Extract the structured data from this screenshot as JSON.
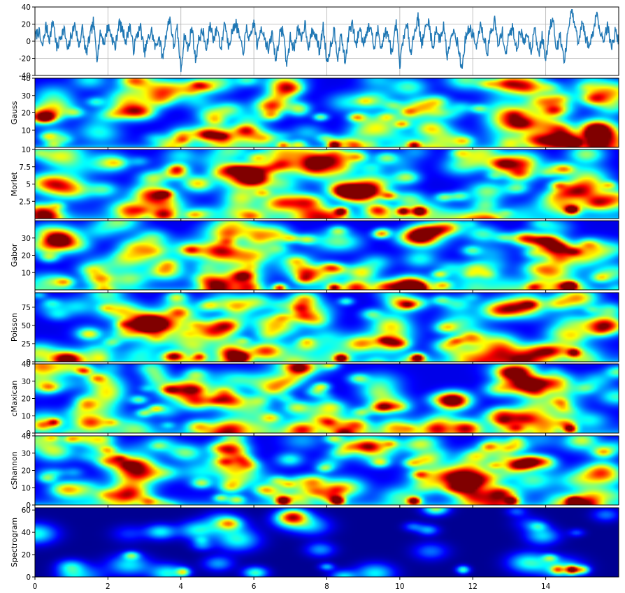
{
  "chart_data": [
    {
      "type": "line",
      "title": "",
      "xlabel": "",
      "ylabel": "",
      "xlim": [
        0,
        16
      ],
      "ylim": [
        -40,
        40
      ],
      "yticks": [
        -20,
        0,
        20,
        40
      ],
      "grid": true,
      "color": "#1f77b4",
      "series": [
        {
          "x": [
            0.0,
            0.1,
            0.2,
            0.3,
            0.4,
            0.5,
            0.6,
            0.7,
            0.8,
            0.9,
            1.0,
            1.1,
            1.2,
            1.3,
            1.4,
            1.5,
            1.6,
            1.7,
            1.8,
            1.9,
            2.0,
            2.1,
            2.2,
            2.3,
            2.4,
            2.5,
            2.6,
            2.7,
            2.8,
            2.9,
            3.0,
            3.1,
            3.2,
            3.3,
            3.4,
            3.5,
            3.6,
            3.7,
            3.8,
            3.9,
            4.0,
            4.1,
            4.2,
            4.3,
            4.4,
            4.5,
            4.6,
            4.7,
            4.8,
            4.9,
            5.0,
            5.1,
            5.2,
            5.3,
            5.4,
            5.5,
            5.6,
            5.7,
            5.8,
            5.9,
            6.0,
            6.1,
            6.2,
            6.3,
            6.4,
            6.5,
            6.6,
            6.7,
            6.8,
            6.9,
            7.0,
            7.1,
            7.2,
            7.3,
            7.4,
            7.5,
            7.6,
            7.7,
            7.8,
            7.9,
            8.0,
            8.1,
            8.2,
            8.3,
            8.4,
            8.5,
            8.6,
            8.7,
            8.8,
            8.9,
            9.0,
            9.1,
            9.2,
            9.3,
            9.4,
            9.5,
            9.6,
            9.7,
            9.8,
            9.9,
            10.0,
            10.1,
            10.2,
            10.3,
            10.4,
            10.5,
            10.6,
            10.7,
            10.8,
            10.9,
            11.0,
            11.1,
            11.2,
            11.3,
            11.4,
            11.5,
            11.6,
            11.7,
            11.8,
            11.9,
            12.0,
            12.1,
            12.2,
            12.3,
            12.4,
            12.5,
            12.6,
            12.7,
            12.8,
            12.9,
            13.0,
            13.1,
            13.2,
            13.3,
            13.4,
            13.5,
            13.6,
            13.7,
            13.8,
            13.9,
            14.0,
            14.1,
            14.2,
            14.3,
            14.4,
            14.5,
            14.6,
            14.7,
            14.8,
            14.9,
            15.0,
            15.1,
            15.2,
            15.3,
            15.4,
            15.5,
            15.6,
            15.7,
            15.8,
            15.9,
            16.0
          ],
          "y": [
            5,
            12,
            -8,
            18,
            2,
            25,
            -10,
            6,
            14,
            -12,
            8,
            20,
            -6,
            15,
            -15,
            4,
            22,
            -18,
            10,
            -2,
            18,
            6,
            -8,
            22,
            12,
            0,
            20,
            -10,
            8,
            16,
            -14,
            2,
            12,
            -8,
            6,
            -20,
            10,
            28,
            -6,
            14,
            -34,
            8,
            -10,
            18,
            -22,
            4,
            12,
            -12,
            20,
            2,
            16,
            -10,
            24,
            -4,
            10,
            22,
            6,
            -14,
            14,
            0,
            24,
            -8,
            18,
            4,
            -12,
            10,
            -22,
            6,
            14,
            -28,
            4,
            -10,
            16,
            0,
            22,
            -8,
            12,
            6,
            -12,
            18,
            -24,
            -6,
            14,
            -18,
            8,
            -26,
            10,
            20,
            -6,
            16,
            -2,
            12,
            18,
            -10,
            14,
            -8,
            12,
            2,
            -16,
            22,
            -30,
            6,
            18,
            -12,
            10,
            28,
            -4,
            14,
            24,
            -10,
            16,
            0,
            20,
            -18,
            8,
            12,
            -6,
            -34,
            4,
            14,
            10,
            -10,
            18,
            6,
            -14,
            12,
            24,
            -8,
            14,
            -16,
            8,
            16,
            -10,
            14,
            -2,
            10,
            -12,
            20,
            -18,
            6,
            -24,
            14,
            28,
            -10,
            8,
            -26,
            6,
            36,
            18,
            -4,
            22,
            2,
            -6,
            12,
            34,
            8,
            4,
            18,
            -8,
            10,
            2
          ]
        }
      ]
    },
    {
      "type": "heatmap",
      "ylabel": "Gauss",
      "xlim": [
        0,
        16
      ],
      "ylim": [
        0,
        40
      ],
      "yticks": [
        10,
        20,
        30,
        40
      ],
      "colormap": "jet",
      "band_frac": 0.05,
      "hotspots": [
        [
          8.2,
          1,
          1.0
        ],
        [
          10.4,
          1,
          0.7
        ],
        [
          14.8,
          2,
          0.85
        ],
        [
          6.8,
          1,
          0.6
        ]
      ]
    },
    {
      "type": "heatmap",
      "ylabel": "Morlet",
      "xlim": [
        0,
        16
      ],
      "ylim": [
        0,
        10
      ],
      "yticks": [
        2.5,
        5.0,
        7.5,
        10.0
      ],
      "colormap": "jet",
      "band_frac": 0.12,
      "hotspots": [
        [
          8.4,
          1,
          0.9
        ],
        [
          10.1,
          1,
          0.85
        ],
        [
          10.55,
          1,
          1.0
        ],
        [
          14.75,
          1.2,
          0.9
        ]
      ]
    },
    {
      "type": "heatmap",
      "ylabel": "Gabor",
      "xlim": [
        0,
        16
      ],
      "ylim": [
        0,
        40
      ],
      "yticks": [
        10,
        20,
        30
      ],
      "colormap": "jet",
      "band_frac": 0.06,
      "hotspots": [
        [
          6.7,
          1,
          0.75
        ],
        [
          8.2,
          1,
          0.8
        ],
        [
          10.5,
          1,
          0.85
        ],
        [
          14.7,
          2,
          1.0
        ]
      ]
    },
    {
      "type": "heatmap",
      "ylabel": "Poisson",
      "xlim": [
        0,
        16
      ],
      "ylim": [
        0,
        95
      ],
      "yticks": [
        0,
        25,
        50,
        75
      ],
      "colormap": "jet",
      "band_frac": 0.1,
      "hotspots": [
        [
          8.4,
          4,
          1.0
        ],
        [
          10.5,
          5,
          0.95
        ],
        [
          14.8,
          12,
          0.7
        ],
        [
          4.5,
          6,
          0.55
        ]
      ]
    },
    {
      "type": "heatmap",
      "ylabel": "cMaxican",
      "xlim": [
        0,
        16
      ],
      "ylim": [
        0,
        40
      ],
      "yticks": [
        0,
        10,
        20,
        30,
        40
      ],
      "colormap": "jet",
      "band_frac": 0.1,
      "hotspots": [
        [
          14.7,
          2,
          0.9
        ],
        [
          0.5,
          6,
          0.6
        ]
      ]
    },
    {
      "type": "heatmap",
      "ylabel": "cShannon",
      "xlim": [
        0,
        16
      ],
      "ylim": [
        0,
        40
      ],
      "yticks": [
        0,
        10,
        20,
        30,
        40
      ],
      "colormap": "jet",
      "band_frac": 0.07,
      "hotspots": [
        [
          6.8,
          2,
          0.95
        ],
        [
          8.3,
          2,
          1.0
        ],
        [
          10.4,
          2,
          1.0
        ],
        [
          14.8,
          2,
          0.95
        ],
        [
          13.1,
          2,
          0.7
        ]
      ]
    },
    {
      "type": "heatmap",
      "ylabel": "Spectrogram",
      "xlim": [
        0,
        16
      ],
      "ylim": [
        0,
        62
      ],
      "yticks": [
        0,
        20,
        40,
        60
      ],
      "colormap": "jet",
      "band_frac": 0.0,
      "hotspots": [
        [
          4.05,
          4,
          0.55
        ],
        [
          11.75,
          6,
          0.5
        ],
        [
          14.35,
          6,
          0.55
        ],
        [
          14.75,
          6,
          1.0
        ],
        [
          15.05,
          6,
          0.55
        ]
      ]
    }
  ],
  "shared_xticks": [
    0,
    2,
    4,
    6,
    8,
    10,
    12,
    14
  ]
}
